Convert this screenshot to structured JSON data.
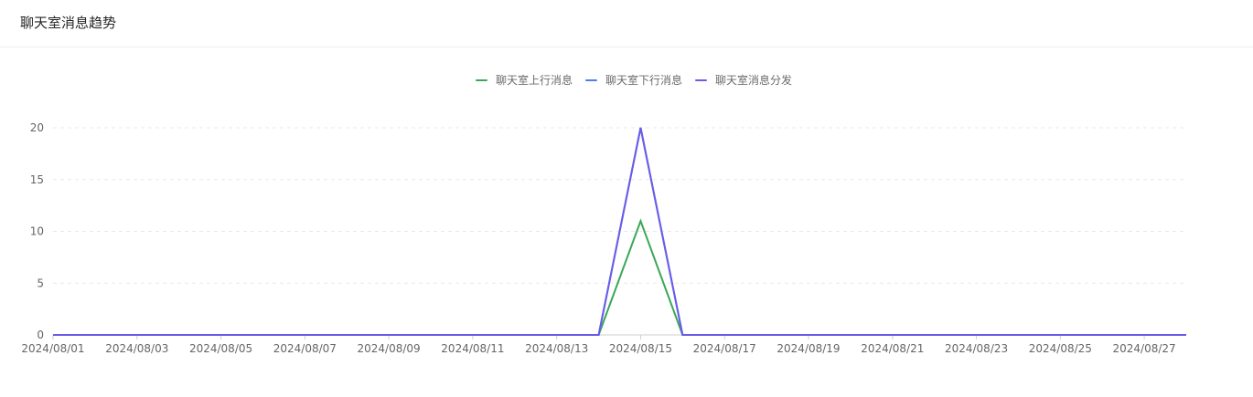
{
  "card": {
    "title": "聊天室消息趋势"
  },
  "chart_data": {
    "type": "line",
    "title": "",
    "xlabel": "",
    "ylabel": "",
    "ylim": [
      0,
      20
    ],
    "yticks": [
      0,
      5,
      10,
      15,
      20
    ],
    "x": [
      "2024/08/01",
      "2024/08/02",
      "2024/08/03",
      "2024/08/04",
      "2024/08/05",
      "2024/08/06",
      "2024/08/07",
      "2024/08/08",
      "2024/08/09",
      "2024/08/10",
      "2024/08/11",
      "2024/08/12",
      "2024/08/13",
      "2024/08/14",
      "2024/08/15",
      "2024/08/16",
      "2024/08/17",
      "2024/08/18",
      "2024/08/19",
      "2024/08/20",
      "2024/08/21",
      "2024/08/22",
      "2024/08/23",
      "2024/08/24",
      "2024/08/25",
      "2024/08/26",
      "2024/08/27",
      "2024/08/28"
    ],
    "xtick_labels": [
      "2024/08/01",
      "2024/08/03",
      "2024/08/05",
      "2024/08/07",
      "2024/08/09",
      "2024/08/11",
      "2024/08/13",
      "2024/08/15",
      "2024/08/17",
      "2024/08/19",
      "2024/08/21",
      "2024/08/23",
      "2024/08/25",
      "2024/08/27"
    ],
    "grid": true,
    "legend_position": "top-center",
    "series": [
      {
        "name": "聊天室上行消息",
        "color": "#3aa757",
        "values": [
          0,
          0,
          0,
          0,
          0,
          0,
          0,
          0,
          0,
          0,
          0,
          0,
          0,
          0,
          11,
          0,
          0,
          0,
          0,
          0,
          0,
          0,
          0,
          0,
          0,
          0,
          0,
          0
        ]
      },
      {
        "name": "聊天室下行消息",
        "color": "#4a7cf5",
        "values": [
          0,
          0,
          0,
          0,
          0,
          0,
          0,
          0,
          0,
          0,
          0,
          0,
          0,
          0,
          20,
          0,
          0,
          0,
          0,
          0,
          0,
          0,
          0,
          0,
          0,
          0,
          0,
          0
        ]
      },
      {
        "name": "聊天室消息分发",
        "color": "#6b5ce7",
        "values": [
          0,
          0,
          0,
          0,
          0,
          0,
          0,
          0,
          0,
          0,
          0,
          0,
          0,
          0,
          20,
          0,
          0,
          0,
          0,
          0,
          0,
          0,
          0,
          0,
          0,
          0,
          0,
          0
        ]
      }
    ]
  }
}
